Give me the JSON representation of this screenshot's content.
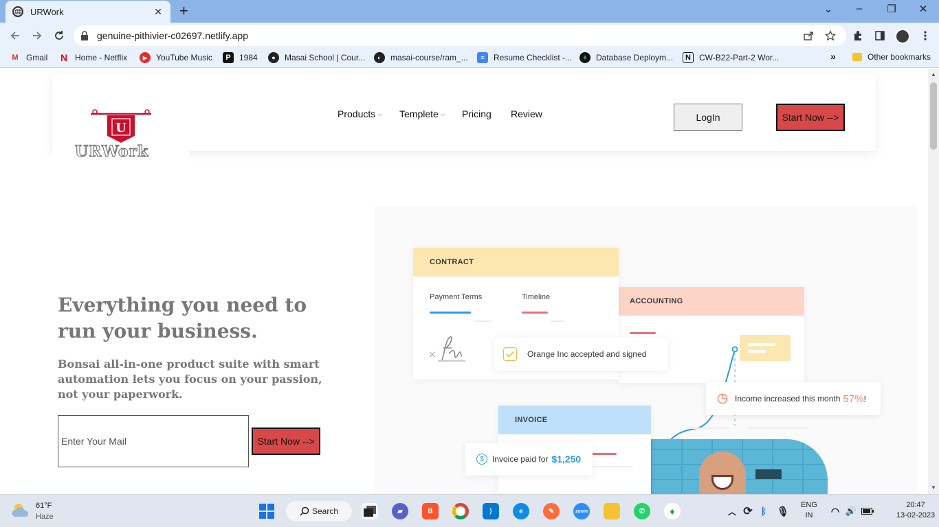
{
  "browser": {
    "tab_title": "URWork",
    "url": "genuine-pithivier-c02697.netlify.app",
    "bookmarks": [
      {
        "label": "Gmail",
        "icon": "gmail-icon"
      },
      {
        "label": "Home - Netflix",
        "icon": "netflix-icon"
      },
      {
        "label": "YouTube Music",
        "icon": "youtube-music-icon"
      },
      {
        "label": "1984",
        "icon": "p-icon"
      },
      {
        "label": "Masai School | Cour...",
        "icon": "globe-icon"
      },
      {
        "label": "masai-course/ram_...",
        "icon": "github-icon"
      },
      {
        "label": "Resume Checklist -...",
        "icon": "docs-icon"
      },
      {
        "label": "Database Deploym...",
        "icon": "mongodb-icon"
      },
      {
        "label": "CW-B22-Part-2 Wor...",
        "icon": "notion-icon"
      }
    ],
    "more_bookmarks": "»",
    "other_bookmarks": "Other bookmarks"
  },
  "header": {
    "logo_text": "URWork",
    "nav": [
      {
        "label": "Products",
        "dropdown": true
      },
      {
        "label": "Templete",
        "dropdown": true
      },
      {
        "label": "Pricing",
        "dropdown": false
      },
      {
        "label": "Review",
        "dropdown": false
      }
    ],
    "login_label": "LogIn",
    "start_label": "Start Now -->"
  },
  "hero": {
    "title": "Everything you need to run your business.",
    "subtitle": "Bonsai all-in-one product suite with smart automation lets you focus on your passion, not your paperwork.",
    "email_placeholder": "Enter Your Mail",
    "start_label": "Start Now -->"
  },
  "illustration": {
    "contract_label": "CONTRACT",
    "payment_terms": "Payment Terms",
    "timeline": "Timeline",
    "accounting_label": "ACCOUNTING",
    "accepted_text": "Orange Inc accepted and signed",
    "income_text": "Income increased this month",
    "income_value": "57%",
    "income_suffix": "!",
    "invoice_label": "INVOICE",
    "invoice_paid_text": "Invoice paid for",
    "invoice_amount": "$1,250"
  },
  "taskbar": {
    "weather_temp": "61°F",
    "weather_desc": "Haze",
    "search_label": "Search",
    "lang_line1": "ENG",
    "lang_line2": "IN",
    "time": "20:47",
    "date": "13-02-2023"
  },
  "colors": {
    "accent_red": "#d94848",
    "contract_yellow": "#fde7b0",
    "accounting_peach": "#fdd5c7",
    "invoice_blue": "#bfe0fb"
  }
}
